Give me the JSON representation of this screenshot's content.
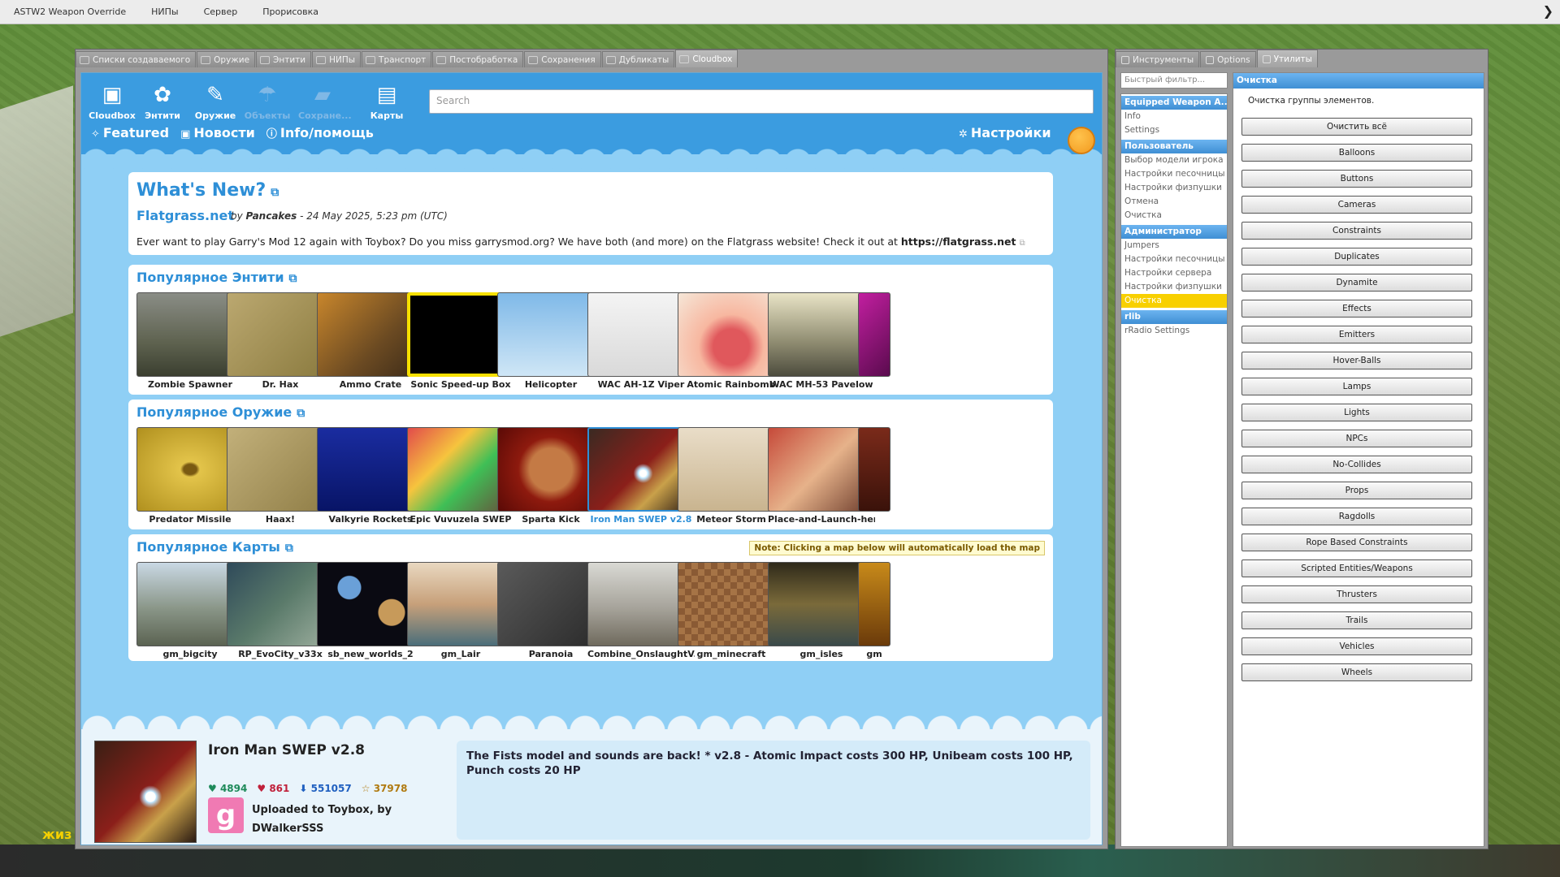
{
  "topmenu": [
    "ASTW2 Weapon Override",
    "НИПы",
    "Сервер",
    "Прорисовка"
  ],
  "main_tabs": [
    "Списки создаваемого",
    "Оружие",
    "Энтити",
    "НИПы",
    "Транспорт",
    "Постобработка",
    "Сохранения",
    "Дубликаты",
    "Cloudbox"
  ],
  "nav": [
    {
      "label": "Cloudbox",
      "icon": "cloudbox-icon",
      "glyph": "▣"
    },
    {
      "label": "Энтити",
      "icon": "lightbulb-icon",
      "glyph": "✿"
    },
    {
      "label": "Оружие",
      "icon": "wand-icon",
      "glyph": "✎"
    },
    {
      "label": "Объекты",
      "icon": "umbrella-icon",
      "glyph": "☂"
    },
    {
      "label": "Сохране...",
      "icon": "folder-icon",
      "glyph": "▰"
    },
    {
      "label": "Карты",
      "icon": "map-icon",
      "glyph": "▤"
    }
  ],
  "search": {
    "placeholder": "Search"
  },
  "sublinks": [
    "Featured",
    "Новости",
    "Info/помощь"
  ],
  "settings_label": "Настройки",
  "whats_new": {
    "title": "What's New?",
    "site": "Flatgrass.net",
    "by_prefix": "by",
    "author": "Pancakes",
    "date": "- 24 May 2025, 5:23 pm (UTC)",
    "text": "Ever want to play Garry's Mod 12 again with Toybox? Do you miss garrysmod.org? We have both (and more) on the Flatgrass website! Check it out at",
    "link": "https://flatgrass.net"
  },
  "sections": [
    {
      "title": "Популярное Энтити",
      "items": [
        "Zombie Spawner",
        "Dr. Hax",
        "Ammo Crate",
        "Sonic Speed-up Box",
        "Helicopter",
        "WAC AH-1Z Viper",
        "Atomic Rainbomb",
        "WAC MH-53 Pavelow",
        ""
      ]
    },
    {
      "title": "Популярное Оружие",
      "items": [
        "Predator Missile",
        "Haax!",
        "Valkyrie Rockets",
        "Epic Vuvuzela SWEP",
        "Sparta Kick",
        "Iron Man SWEP v2.8",
        "Meteor Storm",
        "Place-and-Launch-her",
        ""
      ]
    },
    {
      "title": "Популярное Карты",
      "note": "Note: Clicking a map below will automatically load the map",
      "items": [
        "gm_bigcity",
        "RP_EvoCity_v33x",
        "sb_new_worlds_2",
        "gm_Lair",
        "Paranoia",
        "Combine_OnslaughtV...",
        "gm_minecraft",
        "gm_isles",
        "gm"
      ]
    }
  ],
  "selected": {
    "name": "Iron Man SWEP v2.8",
    "likes": "4894",
    "dislikes": "861",
    "downloads": "551057",
    "favorites": "37978",
    "uploaded": "Uploaded to Toybox, by",
    "uploader": "DWalkerSSS",
    "avatar_letter": "g",
    "description": "The Fists model and sounds are back! * v2.8 - Atomic Impact costs 300 HP, Unibeam costs 100 HP, Punch costs 20 HP"
  },
  "right_tabs": [
    "Инструменты",
    "Options",
    "Утилиты"
  ],
  "filter_placeholder": "Быстрый фильтр...",
  "tree": [
    {
      "cat": "Equipped Weapon A...",
      "items": [
        "Info",
        "Settings"
      ]
    },
    {
      "cat": "Пользователь",
      "items": [
        "Выбор модели игрока",
        "Настройки песочницы",
        "Настройки физпушки",
        "Отмена",
        "Очистка"
      ]
    },
    {
      "cat": "Администратор",
      "items": [
        "Jumpers",
        "Настройки песочницы",
        "Настройки сервера",
        "Настройки физпушки",
        "Очистка"
      ]
    },
    {
      "cat": "rlib",
      "items": [
        "rRadio Settings"
      ]
    }
  ],
  "utility": {
    "header": "Очистка",
    "desc": "Очистка группы элементов.",
    "buttons": [
      "Очистить всё",
      "Balloons",
      "Buttons",
      "Cameras",
      "Constraints",
      "Duplicates",
      "Dynamite",
      "Effects",
      "Emitters",
      "Hover-Balls",
      "Lamps",
      "Lights",
      "NPCs",
      "No-Collides",
      "Props",
      "Ragdolls",
      "Rope Based Constraints",
      "Scripted Entities/Weapons",
      "Thrusters",
      "Trails",
      "Vehicles",
      "Wheels"
    ]
  },
  "hud_text": "жиз"
}
